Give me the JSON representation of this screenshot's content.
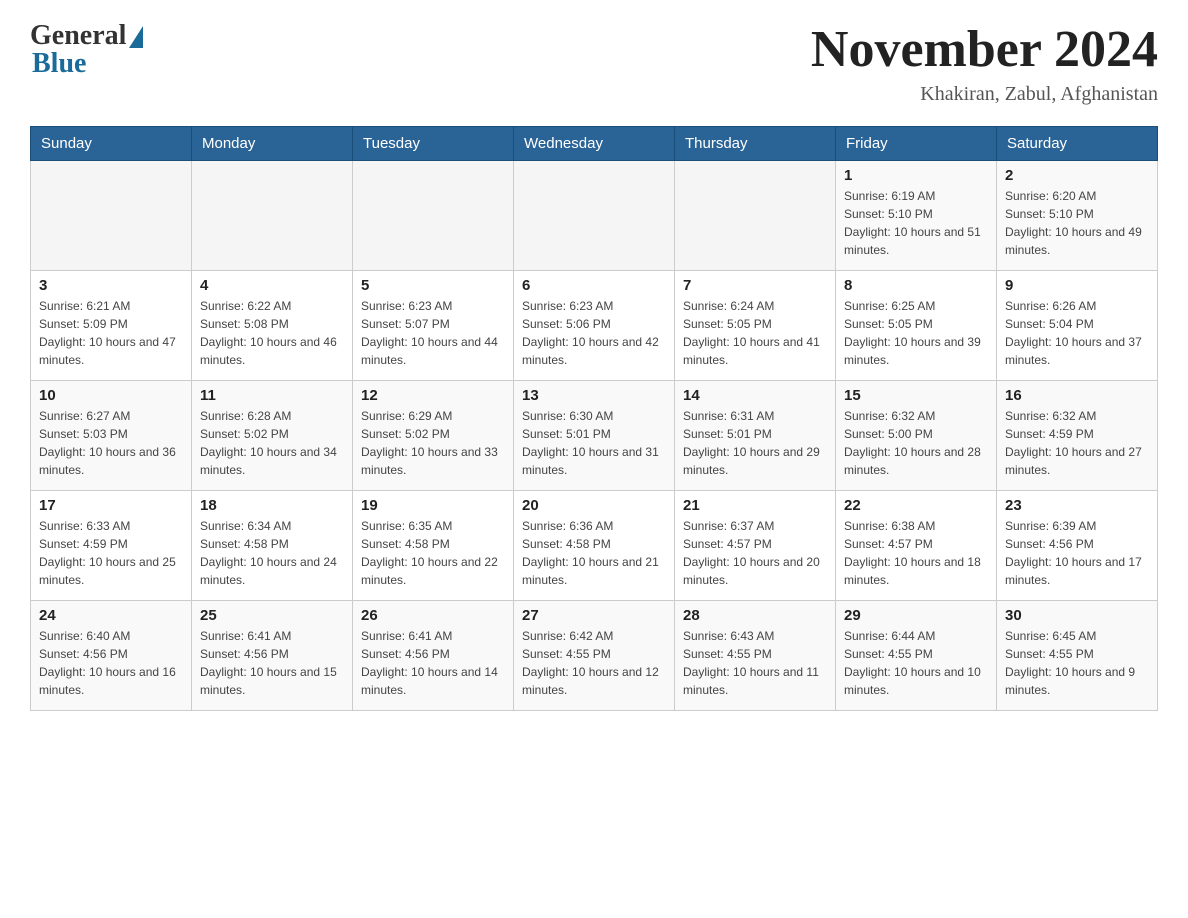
{
  "header": {
    "logo_general": "General",
    "logo_blue": "Blue",
    "month_title": "November 2024",
    "location": "Khakiran, Zabul, Afghanistan"
  },
  "days_of_week": [
    "Sunday",
    "Monday",
    "Tuesday",
    "Wednesday",
    "Thursday",
    "Friday",
    "Saturday"
  ],
  "weeks": [
    [
      {
        "day": "",
        "info": ""
      },
      {
        "day": "",
        "info": ""
      },
      {
        "day": "",
        "info": ""
      },
      {
        "day": "",
        "info": ""
      },
      {
        "day": "",
        "info": ""
      },
      {
        "day": "1",
        "info": "Sunrise: 6:19 AM\nSunset: 5:10 PM\nDaylight: 10 hours and 51 minutes."
      },
      {
        "day": "2",
        "info": "Sunrise: 6:20 AM\nSunset: 5:10 PM\nDaylight: 10 hours and 49 minutes."
      }
    ],
    [
      {
        "day": "3",
        "info": "Sunrise: 6:21 AM\nSunset: 5:09 PM\nDaylight: 10 hours and 47 minutes."
      },
      {
        "day": "4",
        "info": "Sunrise: 6:22 AM\nSunset: 5:08 PM\nDaylight: 10 hours and 46 minutes."
      },
      {
        "day": "5",
        "info": "Sunrise: 6:23 AM\nSunset: 5:07 PM\nDaylight: 10 hours and 44 minutes."
      },
      {
        "day": "6",
        "info": "Sunrise: 6:23 AM\nSunset: 5:06 PM\nDaylight: 10 hours and 42 minutes."
      },
      {
        "day": "7",
        "info": "Sunrise: 6:24 AM\nSunset: 5:05 PM\nDaylight: 10 hours and 41 minutes."
      },
      {
        "day": "8",
        "info": "Sunrise: 6:25 AM\nSunset: 5:05 PM\nDaylight: 10 hours and 39 minutes."
      },
      {
        "day": "9",
        "info": "Sunrise: 6:26 AM\nSunset: 5:04 PM\nDaylight: 10 hours and 37 minutes."
      }
    ],
    [
      {
        "day": "10",
        "info": "Sunrise: 6:27 AM\nSunset: 5:03 PM\nDaylight: 10 hours and 36 minutes."
      },
      {
        "day": "11",
        "info": "Sunrise: 6:28 AM\nSunset: 5:02 PM\nDaylight: 10 hours and 34 minutes."
      },
      {
        "day": "12",
        "info": "Sunrise: 6:29 AM\nSunset: 5:02 PM\nDaylight: 10 hours and 33 minutes."
      },
      {
        "day": "13",
        "info": "Sunrise: 6:30 AM\nSunset: 5:01 PM\nDaylight: 10 hours and 31 minutes."
      },
      {
        "day": "14",
        "info": "Sunrise: 6:31 AM\nSunset: 5:01 PM\nDaylight: 10 hours and 29 minutes."
      },
      {
        "day": "15",
        "info": "Sunrise: 6:32 AM\nSunset: 5:00 PM\nDaylight: 10 hours and 28 minutes."
      },
      {
        "day": "16",
        "info": "Sunrise: 6:32 AM\nSunset: 4:59 PM\nDaylight: 10 hours and 27 minutes."
      }
    ],
    [
      {
        "day": "17",
        "info": "Sunrise: 6:33 AM\nSunset: 4:59 PM\nDaylight: 10 hours and 25 minutes."
      },
      {
        "day": "18",
        "info": "Sunrise: 6:34 AM\nSunset: 4:58 PM\nDaylight: 10 hours and 24 minutes."
      },
      {
        "day": "19",
        "info": "Sunrise: 6:35 AM\nSunset: 4:58 PM\nDaylight: 10 hours and 22 minutes."
      },
      {
        "day": "20",
        "info": "Sunrise: 6:36 AM\nSunset: 4:58 PM\nDaylight: 10 hours and 21 minutes."
      },
      {
        "day": "21",
        "info": "Sunrise: 6:37 AM\nSunset: 4:57 PM\nDaylight: 10 hours and 20 minutes."
      },
      {
        "day": "22",
        "info": "Sunrise: 6:38 AM\nSunset: 4:57 PM\nDaylight: 10 hours and 18 minutes."
      },
      {
        "day": "23",
        "info": "Sunrise: 6:39 AM\nSunset: 4:56 PM\nDaylight: 10 hours and 17 minutes."
      }
    ],
    [
      {
        "day": "24",
        "info": "Sunrise: 6:40 AM\nSunset: 4:56 PM\nDaylight: 10 hours and 16 minutes."
      },
      {
        "day": "25",
        "info": "Sunrise: 6:41 AM\nSunset: 4:56 PM\nDaylight: 10 hours and 15 minutes."
      },
      {
        "day": "26",
        "info": "Sunrise: 6:41 AM\nSunset: 4:56 PM\nDaylight: 10 hours and 14 minutes."
      },
      {
        "day": "27",
        "info": "Sunrise: 6:42 AM\nSunset: 4:55 PM\nDaylight: 10 hours and 12 minutes."
      },
      {
        "day": "28",
        "info": "Sunrise: 6:43 AM\nSunset: 4:55 PM\nDaylight: 10 hours and 11 minutes."
      },
      {
        "day": "29",
        "info": "Sunrise: 6:44 AM\nSunset: 4:55 PM\nDaylight: 10 hours and 10 minutes."
      },
      {
        "day": "30",
        "info": "Sunrise: 6:45 AM\nSunset: 4:55 PM\nDaylight: 10 hours and 9 minutes."
      }
    ]
  ]
}
